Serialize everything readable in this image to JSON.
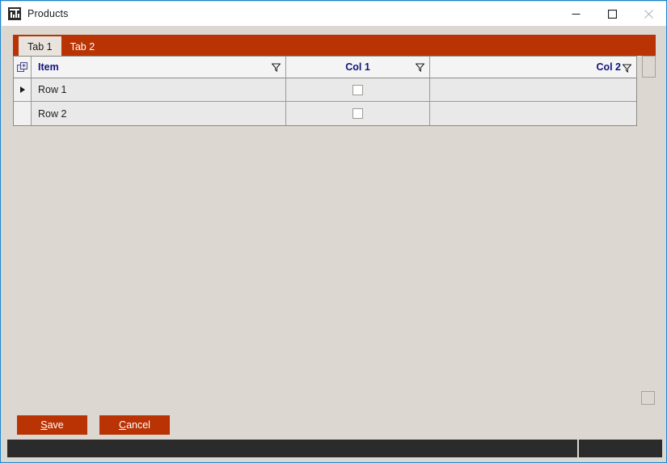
{
  "window": {
    "title": "Products",
    "icon": "table-grid-icon",
    "controls": {
      "minimize_label": "Minimize",
      "maximize_label": "Maximize",
      "close_label": "Close"
    },
    "accent_color": "#b93305",
    "panel_color": "#dcd8d1",
    "border_color": "#1a86d0"
  },
  "tabs": [
    {
      "label": "Tab 1",
      "selected": true
    },
    {
      "label": "Tab 2",
      "selected": false
    }
  ],
  "grid": {
    "columns": [
      {
        "key": "rowsel",
        "label": "",
        "align": "center",
        "filter": false
      },
      {
        "key": "item",
        "label": "Item",
        "align": "left",
        "filter": true
      },
      {
        "key": "col1",
        "label": "Col 1",
        "align": "center",
        "filter": true
      },
      {
        "key": "col2",
        "label": "Col 2",
        "align": "right",
        "filter": true
      }
    ],
    "rows": [
      {
        "current": true,
        "item": "Row 1",
        "col1_checked": false,
        "col2": ""
      },
      {
        "current": false,
        "item": "Row 2",
        "col1_checked": false,
        "col2": ""
      }
    ]
  },
  "buttons": {
    "save": {
      "accel": "S",
      "rest": "ave"
    },
    "cancel": {
      "accel": "C",
      "rest": "ancel"
    }
  },
  "statusbar": {
    "left_text": "",
    "right_text": ""
  }
}
